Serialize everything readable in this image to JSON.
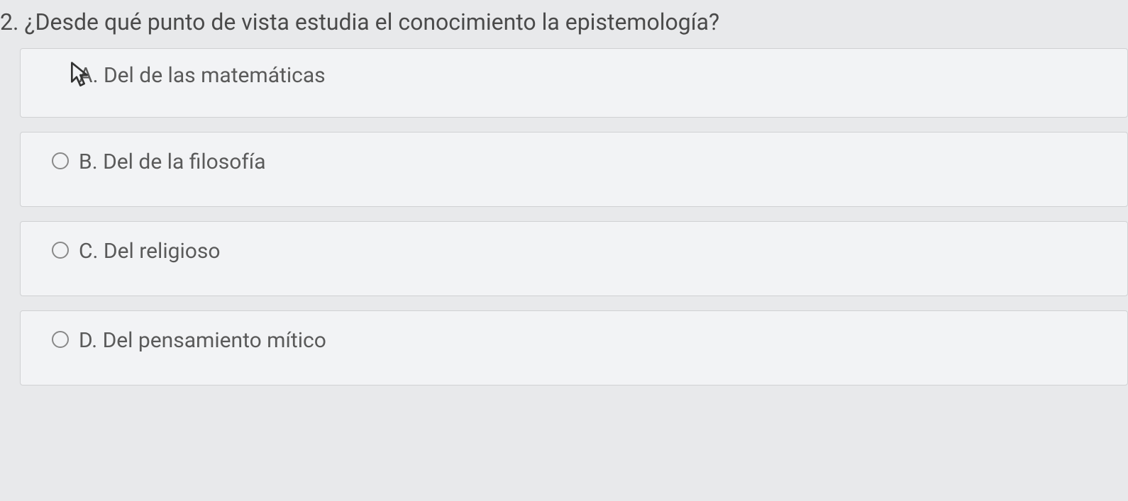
{
  "question": {
    "number": "2.",
    "text": "¿Desde qué punto de vista estudia el conocimiento la epistemología?"
  },
  "options": [
    {
      "letter": "A.",
      "text": "Del de las matemáticas"
    },
    {
      "letter": "B.",
      "text": "Del de la filosofía"
    },
    {
      "letter": "C.",
      "text": "Del religioso"
    },
    {
      "letter": "D.",
      "text": "Del pensamiento mítico"
    }
  ]
}
